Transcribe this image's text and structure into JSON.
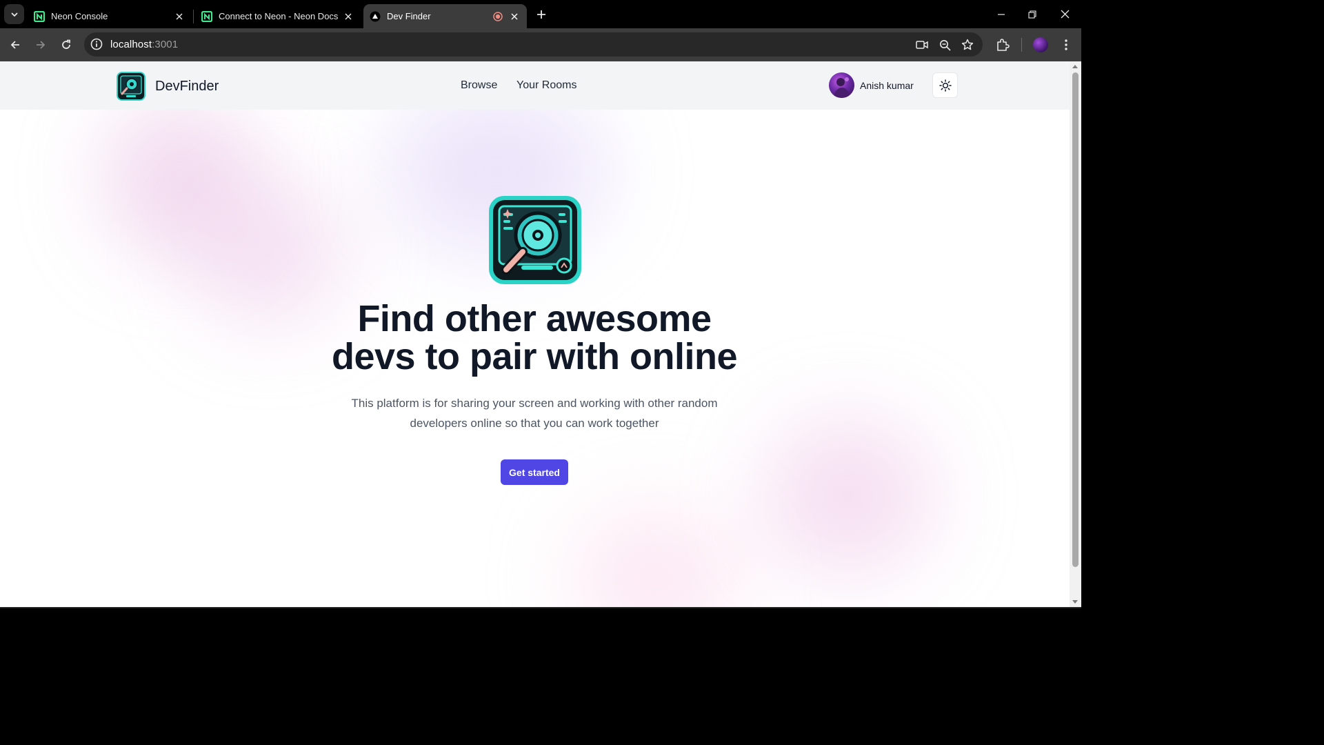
{
  "browser": {
    "tabs": [
      {
        "title": "Neon Console",
        "favicon": "neon-logo-icon",
        "active": false
      },
      {
        "title": "Connect to Neon - Neon Docs",
        "favicon": "neon-logo-icon",
        "active": false
      },
      {
        "title": "Dev Finder",
        "favicon": "triangle-logo-icon",
        "active": true,
        "recording": true
      }
    ],
    "url_host": "localhost",
    "url_port": ":3001"
  },
  "site": {
    "brand": "DevFinder",
    "nav": {
      "browse": "Browse",
      "rooms": "Your Rooms"
    },
    "user_name": "Anish kumar",
    "accent": "#4f46e5"
  },
  "hero": {
    "title_line1": "Find other awesome",
    "title_line2": "devs to pair with online",
    "subtitle": "This platform is for sharing your screen and working with other random developers online so that you can work together",
    "cta": "Get started"
  }
}
